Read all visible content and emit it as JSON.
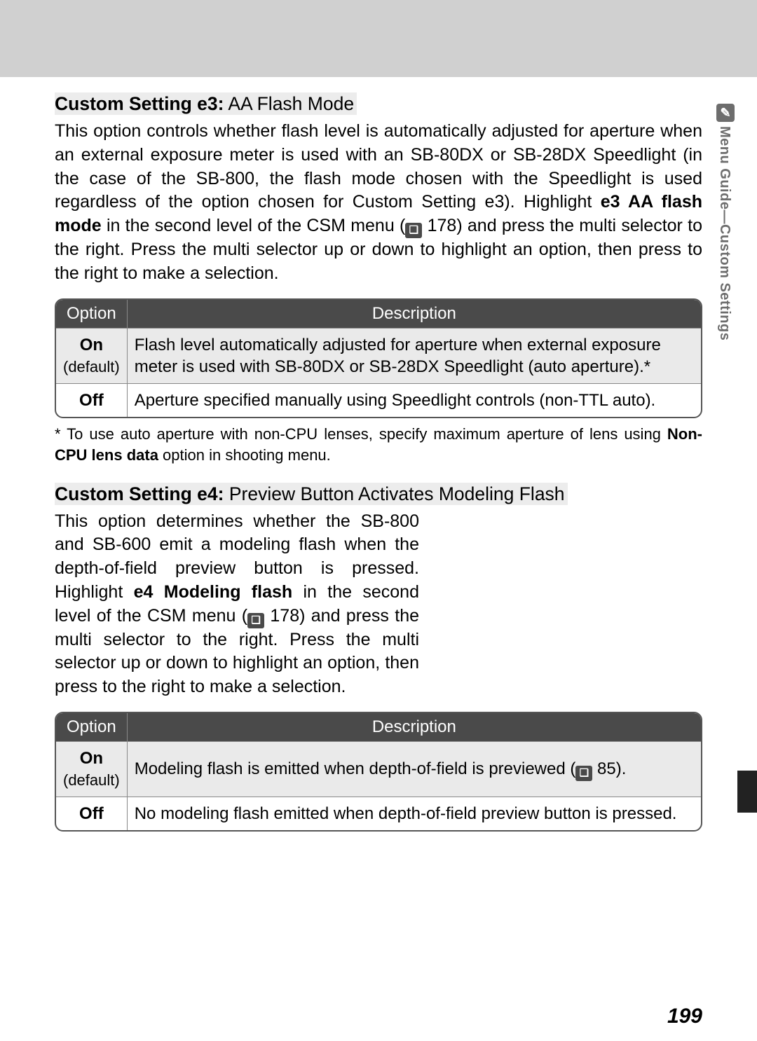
{
  "sidebar": {
    "icon_glyph": "✎",
    "label": "Menu Guide—Custom Settings"
  },
  "page_number": "199",
  "e3": {
    "title_bold": "Custom Setting e3:",
    "title_rest": " AA Flash Mode",
    "para_a": "This option controls whether flash level is automatically adjusted for aperture when an external exposure meter is used with an SB-80DX or SB-28DX Speedlight (in the case of the SB-800, the flash mode chosen with the Speedlight is used regardless of the option chosen for Custom Setting e3).  Highlight ",
    "para_b_bold": "e3 AA flash mode",
    "para_c": " in the second level of the CSM menu (",
    "ref1": "178",
    "para_d": ") and press the multi selector to the right.  Press the multi selector up or down to highlight an option, then press to the right to make a selection.",
    "table": {
      "h_option": "Option",
      "h_desc": "Description",
      "r1_opt": "On",
      "r1_def": "(default)",
      "r1_desc": "Flash level automatically adjusted for aperture when external exposure meter is used with SB-80DX or SB-28DX Speedlight (auto aperture).*",
      "r2_opt": "Off",
      "r2_desc": "Aperture specified manually using Speedlight controls (non-TTL auto)."
    },
    "footnote_a": "* To use auto aperture with non-CPU lenses, specify maximum aperture of lens using ",
    "footnote_b_bold": "Non-CPU lens data",
    "footnote_c": " option in shooting menu."
  },
  "e4": {
    "title_bold": "Custom Setting e4:",
    "title_rest": " Preview Button Activates Modeling Flash",
    "para_a": "This option determines whether the SB-800 and SB-600 emit a modeling flash when the depth-of-field preview button is pressed.  Highlight ",
    "para_b_bold": "e4 Modeling flash",
    "para_c": " in the second level of the CSM menu (",
    "ref1": "178",
    "para_d": ") and press the multi selector to the right.  Press the multi selector up or down to highlight an option, then press to the right to make a selection.",
    "table": {
      "h_option": "Option",
      "h_desc": "Description",
      "r1_opt": "On",
      "r1_def": "(default)",
      "r1_desc_a": "Modeling flash is emitted when depth-of-field is previewed (",
      "r1_ref": "85",
      "r1_desc_b": ").",
      "r2_opt": "Off",
      "r2_desc": "No modeling flash emitted when depth-of-field preview button is pressed."
    }
  }
}
